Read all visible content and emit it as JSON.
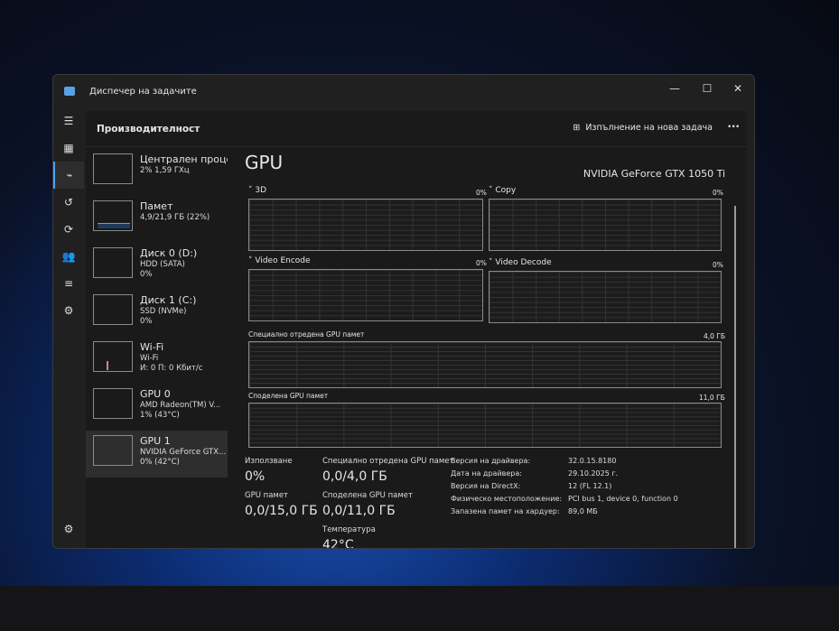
{
  "window": {
    "title": "Диспечер на задачите",
    "min": "—",
    "max": "☐",
    "close": "✕"
  },
  "header": {
    "title": "Производителност",
    "new_task": "Изпълнение на нова задача",
    "more": "···"
  },
  "sidebar": [
    {
      "title": "Централен проце",
      "sub1": "2% 1,59 ГХц",
      "sub2": ""
    },
    {
      "title": "Памет",
      "sub1": "4,9/21,9 ГБ (22%)",
      "sub2": ""
    },
    {
      "title": "Диск 0 (D:)",
      "sub1": "HDD (SATA)",
      "sub2": "0%"
    },
    {
      "title": "Диск 1 (C:)",
      "sub1": "SSD (NVMe)",
      "sub2": "0%"
    },
    {
      "title": "Wi-Fi",
      "sub1": "Wi-Fi",
      "sub2": "И: 0 П: 0 Кбит/с"
    },
    {
      "title": "GPU 0",
      "sub1": "AMD Radeon(TM) V...",
      "sub2": "1% (43°C)"
    },
    {
      "title": "GPU 1",
      "sub1": "NVIDIA GeForce GTX...",
      "sub2": "0% (42°C)"
    }
  ],
  "gpu": {
    "title": "GPU",
    "name": "NVIDIA GeForce GTX 1050 Ti",
    "graphs": [
      {
        "label": "3D",
        "value": "0%"
      },
      {
        "label": "Copy",
        "value": "0%"
      },
      {
        "label": "Video Encode",
        "value": "0%"
      },
      {
        "label": "Video Decode",
        "value": "0%"
      },
      {
        "label": "Специално отредена GPU памет",
        "value": "4,0 ГБ"
      },
      {
        "label": "Споделена GPU памет",
        "value": "11,0 ГБ"
      }
    ],
    "stats": {
      "usage_l": "Използване",
      "usage_v": "0%",
      "ded_l": "Специално отредена GPU памет",
      "ded_v": "0,0/4,0 ГБ",
      "mem_l": "GPU памет",
      "mem_v": "0,0/15,0 ГБ",
      "shared_l": "Споделена GPU памет",
      "shared_v": "0,0/11,0 ГБ",
      "temp_l": "Температура",
      "temp_v": "42°C"
    },
    "info": [
      {
        "k": "Версия на драйвера:",
        "v": "32.0.15.8180"
      },
      {
        "k": "Дата на драйвера:",
        "v": "29.10.2025 г."
      },
      {
        "k": "Версия на DirectX:",
        "v": "12 (FL 12.1)"
      },
      {
        "k": "Физическо местоположение:",
        "v": "PCI bus 1, device 0, function 0"
      },
      {
        "k": "Запазена памет на хардуер:",
        "v": "89,0 МБ"
      }
    ]
  }
}
